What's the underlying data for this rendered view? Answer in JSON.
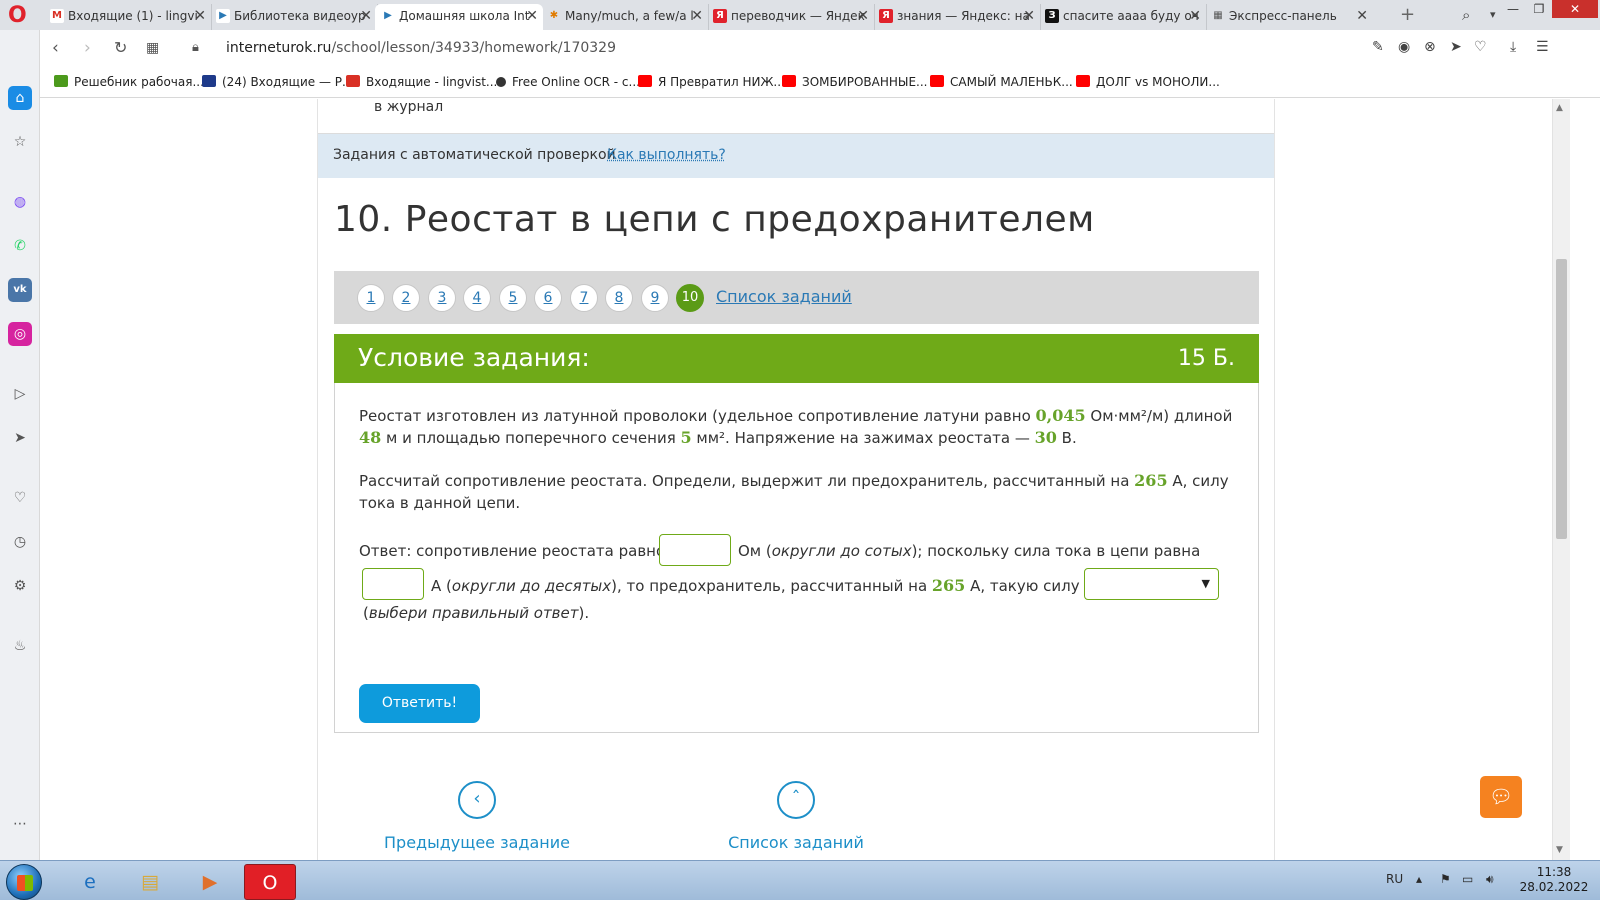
{
  "browser": {
    "tabs": [
      {
        "label": "Входящие (1) - lingvi",
        "favicon": "M",
        "color": "#d93025"
      },
      {
        "label": "Библиотека видеоур",
        "favicon": "▶",
        "color": "#2a79b5"
      },
      {
        "label": "Домашняя школа Int",
        "favicon": "▶",
        "color": "#2a79b5"
      },
      {
        "label": "Many/much, a few/a l",
        "favicon": "✱",
        "color": "#e07b00"
      },
      {
        "label": "переводчик — Яндек",
        "favicon": "Я",
        "color": "#e0222c"
      },
      {
        "label": "знания — Яндекс: на",
        "favicon": "Я",
        "color": "#e0222c"
      },
      {
        "label": "спасите аааа буду оч",
        "favicon": "З",
        "color": "#111111"
      },
      {
        "label": "Экспресс-панель",
        "favicon": "▦",
        "color": "#555555"
      }
    ],
    "url_host": "interneturok.ru",
    "url_path": "/school/lesson/34933/homework/170329",
    "bookmarks": [
      {
        "label": "Решебник рабочая...",
        "color": "#4c9a1c"
      },
      {
        "label": "(24) Входящие — Р...",
        "color": "#1e3a8a"
      },
      {
        "label": "Входящие - lingvist...",
        "color": "#d93025"
      },
      {
        "label": "Free Online OCR - c...",
        "color": "#333333"
      },
      {
        "label": "Я Превратил НИЖ...",
        "color": "#ff0000"
      },
      {
        "label": "ЗОМБИРОВАННЫЕ...",
        "color": "#ff0000"
      },
      {
        "label": "САМЫЙ МАЛЕНЬК...",
        "color": "#ff0000"
      },
      {
        "label": "ДОЛГ vs МОНОЛИ...",
        "color": "#ff0000"
      }
    ]
  },
  "page": {
    "journal_text": "в журнал",
    "auto_check_label": "Задания с автоматической проверкой",
    "how_to_link": "Как выполнять?",
    "task_title": "10. Реостат в цепи с предохранителем",
    "pager": {
      "numbers": [
        "1",
        "2",
        "3",
        "4",
        "5",
        "6",
        "7",
        "8",
        "9",
        "10"
      ],
      "active_index": 9,
      "list_link": "Список заданий"
    },
    "condition": {
      "title": "Условие задания:",
      "points": "15 Б.",
      "p1_a": "Реостат изготовлен из латунной проволоки (удельное сопротивление латуни равно ",
      "p1_v1": "0,045",
      "p1_b": " Ом·мм²/м) длиной ",
      "p1_v2": "48",
      "p1_c": " м и площадью поперечного сечения ",
      "p1_v3": "5",
      "p1_d": " мм². Напряжение на зажимах реостата — ",
      "p1_v4": "30",
      "p1_e": " В.",
      "p2_a": "Рассчитай сопротивление реостата. Определи, выдержит ли предохранитель, рассчитанный на ",
      "p2_v1": "265",
      "p2_b": " А, силу тока в данной цепи.",
      "ans_a": "Ответ: сопротивление реостата равно",
      "ans_b": "Ом (",
      "ans_b_i": "округли до сотых",
      "ans_c": "); поскольку сила тока в цепи равна",
      "ans_d": "А (",
      "ans_d_i": "округли до десятых",
      "ans_e": "), то предохранитель, рассчитанный на ",
      "ans_e_v": "265",
      "ans_f": " А, такую силу тока",
      "ans_g_open": "(",
      "ans_g_i": "выбери правильный ответ",
      "ans_g_close": ").",
      "resistance_value": "",
      "current_value": "",
      "select_value": ""
    },
    "submit_label": "Ответить!",
    "prev_task": "Предыдущее задание",
    "task_list": "Список заданий"
  },
  "taskbar": {
    "lang": "RU",
    "time": "11:38",
    "date": "28.02.2022"
  }
}
